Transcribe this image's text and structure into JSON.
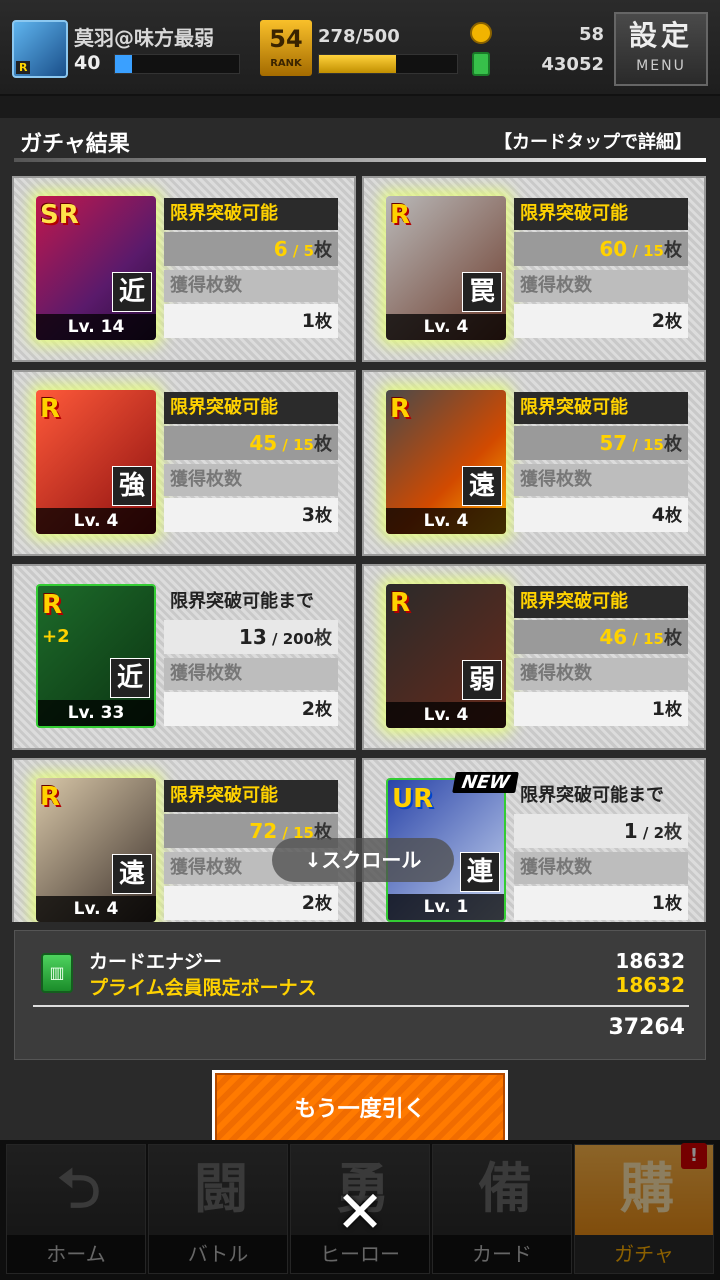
{
  "player": {
    "name": "莫羽@味方最弱",
    "level": "40",
    "exp_fraction": 0.14,
    "rank": "54",
    "rank_label": "RANK",
    "stamina": "278/500",
    "stamina_fraction": 0.556,
    "coins": "58",
    "card_energy": "43052"
  },
  "menu": {
    "title": "設定",
    "sub": "MENU"
  },
  "panel": {
    "title": "ガチャ結果",
    "hint": "【カードタップで詳細】"
  },
  "cards": [
    {
      "rarity": "SR",
      "type": "近",
      "level": "Lv. 14",
      "limit_label": "限界突破可能",
      "limit_have": "6",
      "limit_need": "5",
      "unit": "枚",
      "obtained_label": "獲得枚数",
      "obtained": "1",
      "new": ""
    },
    {
      "rarity": "R",
      "type": "罠",
      "level": "Lv. 4",
      "limit_label": "限界突破可能",
      "limit_have": "60",
      "limit_need": "15",
      "unit": "枚",
      "obtained_label": "獲得枚数",
      "obtained": "2",
      "new": ""
    },
    {
      "rarity": "R",
      "type": "強",
      "level": "Lv. 4",
      "limit_label": "限界突破可能",
      "limit_have": "45",
      "limit_need": "15",
      "unit": "枚",
      "obtained_label": "獲得枚数",
      "obtained": "3",
      "new": ""
    },
    {
      "rarity": "R",
      "type": "遠",
      "level": "Lv. 4",
      "limit_label": "限界突破可能",
      "limit_have": "57",
      "limit_need": "15",
      "unit": "枚",
      "obtained_label": "獲得枚数",
      "obtained": "4",
      "new": ""
    },
    {
      "rarity": "R",
      "type": "近",
      "level": "Lv. 33",
      "plus": "+2",
      "limit_label": "限界突破可能まで",
      "limit_have": "13",
      "limit_need": "200",
      "unit": "枚",
      "obtained_label": "獲得枚数",
      "obtained": "2",
      "new": ""
    },
    {
      "rarity": "R",
      "type": "弱",
      "level": "Lv. 4",
      "limit_label": "限界突破可能",
      "limit_have": "46",
      "limit_need": "15",
      "unit": "枚",
      "obtained_label": "獲得枚数",
      "obtained": "1",
      "new": ""
    },
    {
      "rarity": "R",
      "type": "遠",
      "level": "Lv. 4",
      "limit_label": "限界突破可能",
      "limit_have": "72",
      "limit_need": "15",
      "unit": "枚",
      "obtained_label": "獲得枚数",
      "obtained": "2",
      "new": ""
    },
    {
      "rarity": "UR",
      "type": "連",
      "level": "Lv. 1",
      "limit_label": "限界突破可能まで",
      "limit_have": "1",
      "limit_need": "2",
      "unit": "枚",
      "obtained_label": "獲得枚数",
      "obtained": "1",
      "new": "NEW"
    }
  ],
  "scroll_hint": "↓スクロール",
  "energy": {
    "label": "カードエナジー",
    "value": "18632",
    "bonus_label": "プライム会員限定ボーナス",
    "bonus_value": "18632",
    "total": "37264"
  },
  "again_button": "もう一度引く",
  "nav": [
    {
      "label": "ホーム",
      "glyph": "⮌"
    },
    {
      "label": "バトル",
      "glyph": "闘"
    },
    {
      "label": "ヒーロー",
      "glyph": "勇"
    },
    {
      "label": "カード",
      "glyph": "備"
    },
    {
      "label": "ガチャ",
      "glyph": "購",
      "badge": "!"
    }
  ],
  "close_glyph": "✕",
  "colors": {
    "accent": "#ffd200",
    "button": "#ff7a00",
    "card_glow": "#e6ff78"
  }
}
